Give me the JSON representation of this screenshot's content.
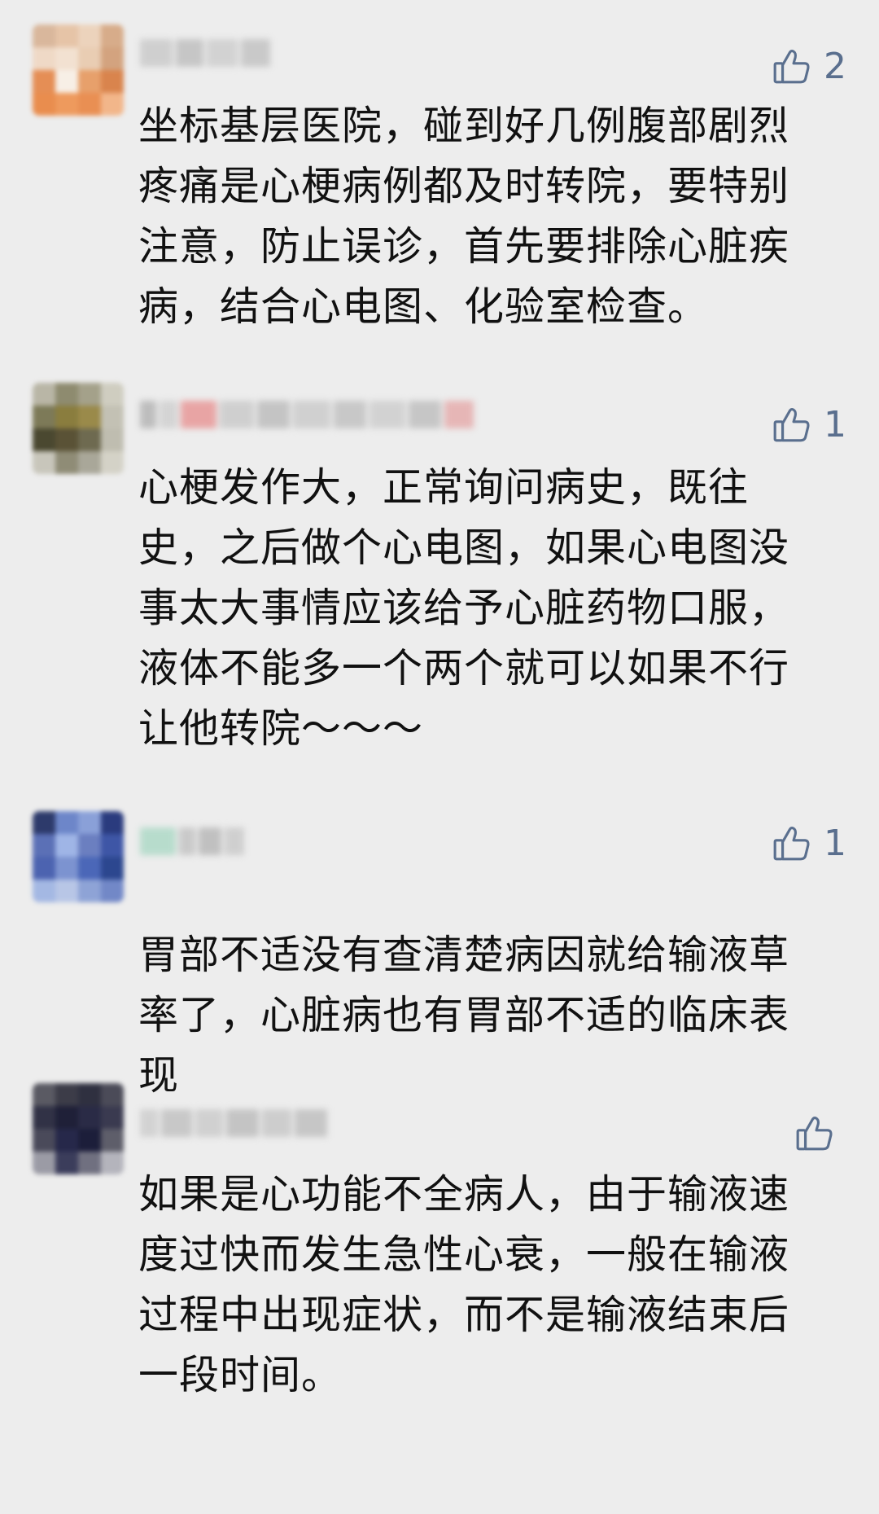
{
  "comments": [
    {
      "likes": "2",
      "text": "坐标基层医院，碰到好几例腹部剧烈疼痛是心梗病例都及时转院，要特别注意，防止误诊，首先要排除心脏疾病，结合心电图、化验室检查。"
    },
    {
      "likes": "1",
      "text": "心梗发作大，正常询问病史，既往史，之后做个心电图，如果心电图没事太大事情应该给予心脏药物口服，液体不能多一个两个就可以如果不行让他转院～～～"
    },
    {
      "likes": "1",
      "text": "胃部不适没有查清楚病因就给输液草率了，心脏病也有胃部不适的临床表现"
    },
    {
      "likes": "",
      "text": "如果是心功能不全病人，由于输液速度过快而发生急性心衰，一般在输液过程中出现症状，而不是输液结束后一段时间。"
    }
  ],
  "icons": {
    "like": "thumbs-up-icon"
  },
  "colors": {
    "background": "#ededed",
    "text": "#111111",
    "like": "#5a6f8e"
  }
}
